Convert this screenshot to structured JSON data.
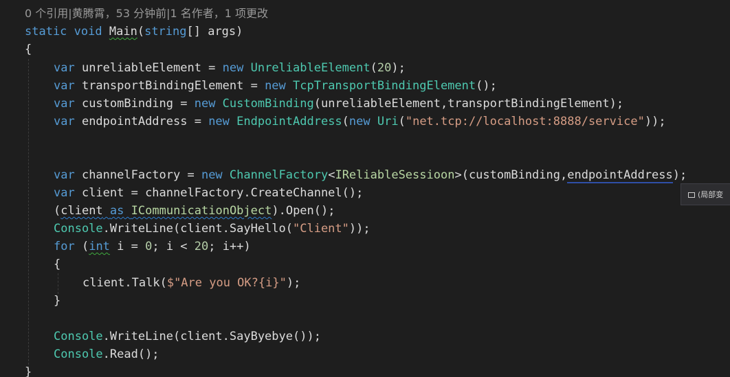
{
  "codelens": "0 个引用|黄腾霄，53 分钟前|1 名作者，1 项更改",
  "tooltip": {
    "icon": "local-variable-icon",
    "text": "(局部变"
  },
  "code": {
    "l1": {
      "kw1": "static",
      "kw2": "void",
      "method": "Main",
      "p1": "(",
      "type": "string",
      "p2": "[] args)"
    },
    "l2": {
      "brace": "{"
    },
    "l3": {
      "var": "var",
      "name": " unreliableElement = ",
      "new": "new",
      "type": " UnreliableElement",
      "p1": "(",
      "num": "20",
      "p2": ");"
    },
    "l4": {
      "var": "var",
      "name": " transportBindingElement = ",
      "new": "new",
      "type": " TcpTransportBindingElement",
      "rest": "();"
    },
    "l5": {
      "var": "var",
      "name": " customBinding = ",
      "new": "new",
      "type": " CustomBinding",
      "rest": "(unreliableElement,transportBindingElement);"
    },
    "l6": {
      "var": "var",
      "name": " endpointAddress = ",
      "new": "new",
      "type": " EndpointAddress",
      "p1": "(",
      "new2": "new",
      "type2": " Uri",
      "p2": "(",
      "str": "\"net.tcp://localhost:8888/service\"",
      "p3": "));"
    },
    "l7": {
      "var": "var",
      "name": " channelFactory = ",
      "new": "new",
      "type": " ChannelFactory",
      "lt": "<",
      "iface": "IReliableSessioon",
      "gt": ">",
      "p1": "(customBinding,",
      "arg": "endpointAddress",
      "p2": ");"
    },
    "l8": {
      "var": "var",
      "rest": " client = channelFactory.CreateChannel();"
    },
    "l9": {
      "p1": "(",
      "client": "client",
      "sp": " ",
      "as": "as",
      "sp2": " ",
      "iface": "ICommunicationObject",
      "p2": ").Open();"
    },
    "l10": {
      "cls": "Console",
      "p1": ".WriteLine(client.SayHello(",
      "str": "\"Client\"",
      "p2": "));"
    },
    "l11": {
      "for": "for",
      "p1": " (",
      "int": "int",
      "p2": " i = ",
      "n0": "0",
      "p3": "; i < ",
      "n20": "20",
      "p4": "; i++)"
    },
    "l12": {
      "brace": "{"
    },
    "l13": {
      "p1": "client.Talk(",
      "str": "$\"Are you OK?{i}\"",
      "p2": ");"
    },
    "l14": {
      "brace": "}"
    },
    "l15": {
      "cls": "Console",
      "rest": ".WriteLine(client.SayByebye());"
    },
    "l16": {
      "cls": "Console",
      "rest": ".Read();"
    },
    "l17": {
      "brace": "}"
    }
  }
}
